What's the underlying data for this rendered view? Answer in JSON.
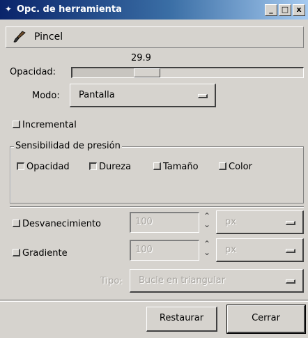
{
  "window": {
    "title": "Opc. de herramienta",
    "title_icon": "gimp-icon",
    "controls": {
      "minimize": "_",
      "maximize": "□",
      "close": "x"
    }
  },
  "tool": {
    "name": "Pincel",
    "icon": "brush-icon"
  },
  "opacity": {
    "label": "Opacidad:",
    "value_text": "29.9",
    "fraction": 0.299
  },
  "mode": {
    "label": "Modo:",
    "value": "Pantalla"
  },
  "incremental": {
    "label": "Incremental",
    "checked": false
  },
  "pressure": {
    "title": "Sensibilidad de presión",
    "options": [
      {
        "label": "Opacidad",
        "checked": true
      },
      {
        "label": "Dureza",
        "checked": true
      },
      {
        "label": "Tamaño",
        "checked": false
      },
      {
        "label": "Color",
        "checked": false
      }
    ]
  },
  "fade": {
    "label": "Desvanecimiento",
    "value": "100",
    "unit": "px",
    "enabled": false
  },
  "gradient": {
    "label": "Gradiente",
    "value": "100",
    "unit": "px",
    "enabled": false,
    "type_label": "Tipo:",
    "type_value": "Bucle en triangular"
  },
  "buttons": {
    "reset": "Restaurar",
    "close": "Cerrar"
  },
  "colors": {
    "titlebar_start": "#0a246a",
    "titlebar_end": "#a6caf0",
    "surface": "#d6d3ce"
  }
}
